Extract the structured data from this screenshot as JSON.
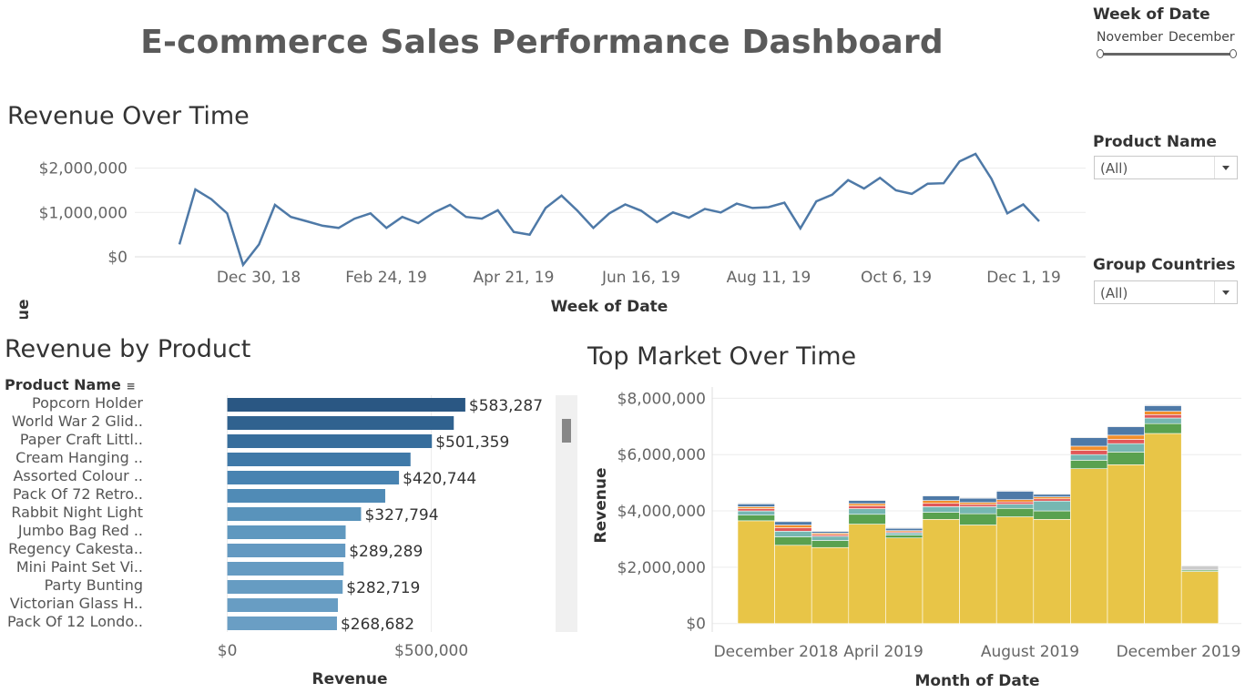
{
  "dashboard_title": "E-commerce Sales Performance Dashboard",
  "filters": {
    "week": {
      "label": "Week of Date",
      "start": "November",
      "end": "December"
    },
    "product": {
      "label": "Product Name",
      "value": "(All)"
    },
    "countries": {
      "label": "Group Countries",
      "value": "(All)"
    }
  },
  "revenue_over_time": {
    "title": "Revenue Over Time",
    "chart_data": {
      "type": "line",
      "title": "Revenue Over Time",
      "xlabel": "Week of Date",
      "ylabel": "Revenue",
      "ylim": [
        0,
        2300000
      ],
      "y_ticks": [
        "$0",
        "$1,000,000",
        "$2,000,000"
      ],
      "y_tick_values": [
        0,
        1000000,
        2000000
      ],
      "x_ticks": [
        "Dec 30, 18",
        "Feb 24, 19",
        "Apr 21, 19",
        "Jun 16, 19",
        "Aug 11, 19",
        "Oct 6, 19",
        "Dec 1, 19"
      ],
      "color": "#4e79a7",
      "series": [
        {
          "values": [
            280000,
            1520000,
            1300000,
            980000,
            -180000,
            280000,
            1170000,
            900000,
            800000,
            700000,
            650000,
            860000,
            980000,
            650000,
            900000,
            760000,
            1000000,
            1170000,
            900000,
            860000,
            1050000,
            560000,
            500000,
            1100000,
            1380000,
            1040000,
            650000,
            980000,
            1180000,
            1040000,
            780000,
            1000000,
            880000,
            1080000,
            1000000,
            1200000,
            1100000,
            1120000,
            1220000,
            640000,
            1250000,
            1400000,
            1730000,
            1540000,
            1780000,
            1500000,
            1420000,
            1650000,
            1660000,
            2150000,
            2320000,
            1760000,
            980000,
            1180000,
            800000
          ]
        }
      ]
    }
  },
  "revenue_by_product": {
    "title": "Revenue by Product",
    "column_header": "Product Name",
    "chart_data": {
      "type": "bar",
      "orientation": "horizontal",
      "title": "Revenue by Product",
      "xlabel": "Revenue",
      "xlim": [
        -200000,
        800000
      ],
      "x_ticks": [
        "$0",
        "$500,000"
      ],
      "x_tick_values": [
        0,
        500000
      ],
      "categories": [
        "Popcorn Holder",
        "World War 2 Glid..",
        "Paper Craft Littl..",
        "Cream Hanging ..",
        "Assorted Colour ..",
        "Pack Of 72 Retro..",
        "Rabbit Night Light",
        "Jumbo Bag Red ..",
        "Regency Cakesta..",
        "Mini Paint Set Vi..",
        "Party Bunting",
        "Victorian Glass H..",
        "Pack Of 12 Londo.."
      ],
      "values": [
        583287,
        555000,
        501359,
        449000,
        420744,
        387000,
        327794,
        290000,
        289289,
        285000,
        282719,
        271000,
        268682
      ],
      "data_labels": [
        "$583,287",
        "",
        "$501,359",
        "",
        "$420,744",
        "",
        "$327,794",
        "",
        "$289,289",
        "",
        "$282,719",
        "",
        "$268,682"
      ],
      "colors": [
        "#2a5783",
        "#30628f",
        "#376e9c",
        "#3f79a8",
        "#4883b1",
        "#508bb6",
        "#5993bb",
        "#5f98bf",
        "#6399c1",
        "#659bc2",
        "#669cc2",
        "#689dc3",
        "#6a9ec4"
      ]
    }
  },
  "top_market": {
    "title": "Top Market Over Time",
    "chart_data": {
      "type": "bar",
      "stacked": true,
      "title": "Top Market Over Time",
      "xlabel": "Month of Date",
      "ylabel": "Revenue",
      "ylim": [
        -300000,
        8400000
      ],
      "y_ticks": [
        "$0",
        "$2,000,000",
        "$4,000,000",
        "$6,000,000",
        "$8,000,000"
      ],
      "y_tick_values": [
        0,
        2000000,
        4000000,
        6000000,
        8000000
      ],
      "x_ticks": [
        "December 2018",
        "April 2019",
        "August 2019",
        "December 2019"
      ],
      "categories": [
        "Dec 2018",
        "Jan 2019",
        "Feb 2019",
        "Mar 2019",
        "Apr 2019",
        "May 2019",
        "Jun 2019",
        "Jul 2019",
        "Aug 2019",
        "Sep 2019",
        "Oct 2019",
        "Nov 2019",
        "Dec 2019"
      ],
      "series": [
        {
          "color": "#e8c547",
          "values": [
            3650000,
            2780000,
            2700000,
            3530000,
            3040000,
            3700000,
            3500000,
            3790000,
            3700000,
            5500000,
            5640000,
            6750000,
            1850000
          ]
        },
        {
          "color": "#59a14f",
          "values": [
            200000,
            300000,
            250000,
            350000,
            100000,
            250000,
            400000,
            300000,
            300000,
            300000,
            450000,
            350000,
            50000
          ]
        },
        {
          "color": "#76b7b2",
          "values": [
            150000,
            200000,
            150000,
            200000,
            80000,
            200000,
            250000,
            150000,
            350000,
            200000,
            300000,
            200000,
            0
          ]
        },
        {
          "color": "#e15759",
          "values": [
            80000,
            120000,
            60000,
            100000,
            40000,
            120000,
            80000,
            80000,
            80000,
            150000,
            150000,
            120000,
            0
          ]
        },
        {
          "color": "#f28e2b",
          "values": [
            70000,
            100000,
            50000,
            80000,
            40000,
            100000,
            70000,
            80000,
            70000,
            150000,
            150000,
            120000,
            0
          ]
        },
        {
          "color": "#4e79a7",
          "values": [
            100000,
            120000,
            60000,
            110000,
            80000,
            160000,
            150000,
            300000,
            90000,
            300000,
            300000,
            200000,
            0
          ]
        },
        {
          "color": "#cccccc",
          "values": [
            30000,
            30000,
            30000,
            30000,
            30000,
            30000,
            30000,
            30000,
            30000,
            30000,
            30000,
            30000,
            150000
          ]
        }
      ]
    }
  }
}
